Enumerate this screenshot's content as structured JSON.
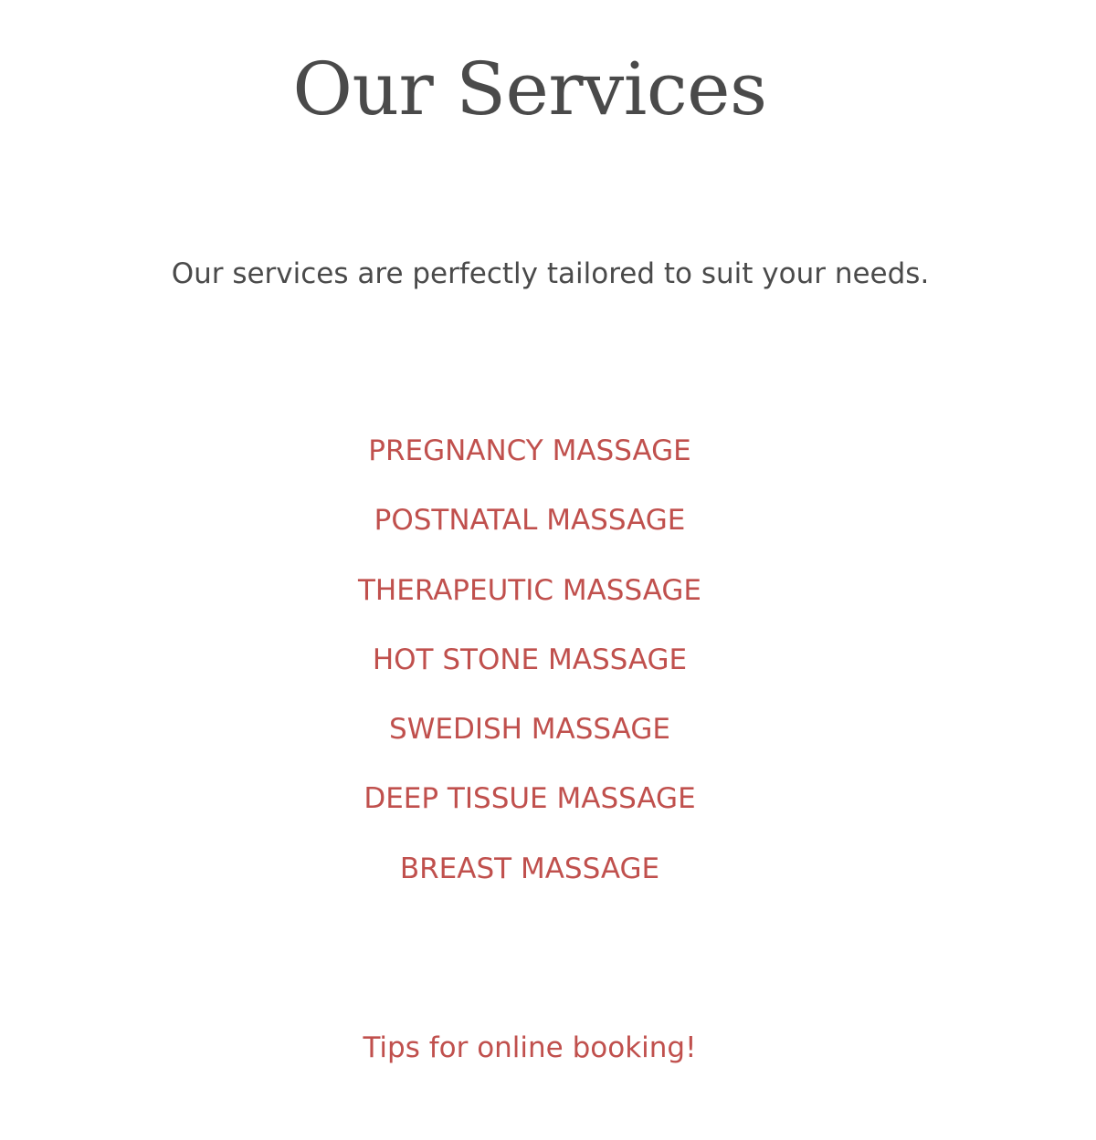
{
  "page": {
    "title": "Our Services",
    "subtitle": "Our services are perfectly tailored to suit your needs."
  },
  "services": [
    {
      "label": "PREGNANCY MASSAGE"
    },
    {
      "label": "POSTNATAL MASSAGE"
    },
    {
      "label": "THERAPEUTIC MASSAGE"
    },
    {
      "label": "HOT STONE MASSAGE"
    },
    {
      "label": "SWEDISH MASSAGE"
    },
    {
      "label": "DEEP TISSUE MASSAGE"
    },
    {
      "label": "BREAST MASSAGE"
    }
  ],
  "tips_link": "Tips for online booking!",
  "colors": {
    "text": "#4a4a4a",
    "link": "#c0504d",
    "background": "#ffffff"
  }
}
